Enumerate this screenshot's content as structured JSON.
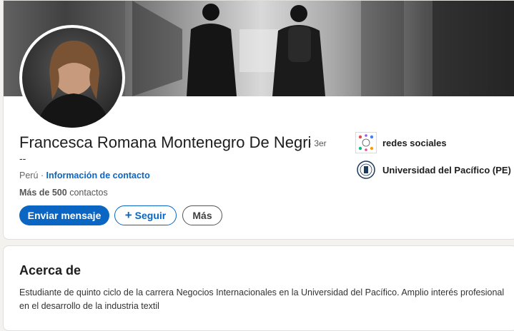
{
  "profile": {
    "name": "Francesca Romana Montenegro De Negri",
    "degree": "· 3er",
    "headline": "--",
    "location": "Perú",
    "separator": "·",
    "contact_link": "Información de contacto",
    "connections_bold": "Más de 500",
    "connections_rest": "contactos"
  },
  "actions": {
    "message_label": "Enviar mensaje",
    "follow_label": "Seguir",
    "more_label": "Más"
  },
  "side": [
    {
      "label": "redes sociales",
      "icon": "social-networks-logo"
    },
    {
      "label": "Universidad del Pacífico (PE)",
      "icon": "university-seal-logo"
    }
  ],
  "about": {
    "title": "Acerca de",
    "text": "Estudiante de quinto ciclo de la carrera Negocios Internacionales en la Universidad del Pacífico. Amplio interés profesional en el desarrollo de la industria textil"
  },
  "colors": {
    "accent": "#0a66c2",
    "page_bg": "#f4f2ee"
  }
}
